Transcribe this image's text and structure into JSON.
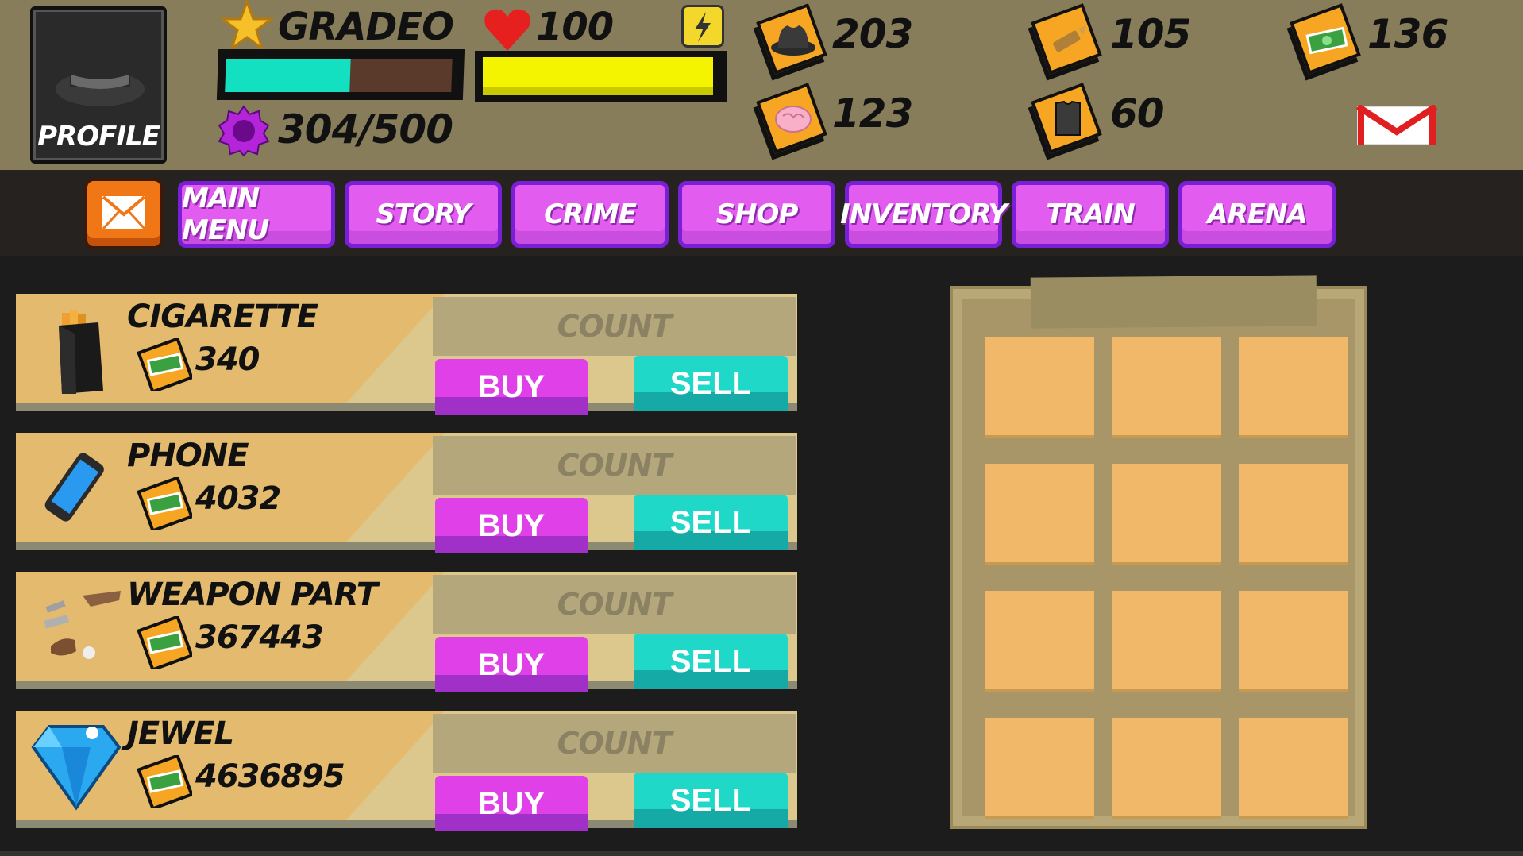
{
  "profile": {
    "label": "PROFILE"
  },
  "player": {
    "name": "GRADEO",
    "xp_fraction": 0.55,
    "respect": "304/500",
    "health": "100",
    "energy_fraction": 1.0
  },
  "resources": {
    "hats": "203",
    "ammo": "105",
    "cash": "136",
    "brains": "123",
    "armor": "60"
  },
  "nav": {
    "items": [
      "MAIN MENU",
      "STORY",
      "CRIME",
      "SHOP",
      "INVENTORY",
      "TRAIN",
      "ARENA"
    ]
  },
  "shop": {
    "count_placeholder": "COUNT",
    "buy_label": "BUY",
    "sell_label": "SELL",
    "items": [
      {
        "name": "CIGARETTE",
        "price": "340",
        "icon": "cigarette-pack-icon"
      },
      {
        "name": "PHONE",
        "price": "4032",
        "icon": "phone-icon"
      },
      {
        "name": "WEAPON PART",
        "price": "367443",
        "icon": "weapon-part-icon"
      },
      {
        "name": "JEWEL",
        "price": "4636895",
        "icon": "jewel-icon"
      }
    ]
  },
  "colors": {
    "hud_bg": "#877d5b",
    "nav_bg": "#262220",
    "nav_button": "#e35cf0",
    "buy": "#e040e8",
    "sell": "#20d8c8",
    "xp": "#12e0c1",
    "energy": "#f4f400"
  }
}
